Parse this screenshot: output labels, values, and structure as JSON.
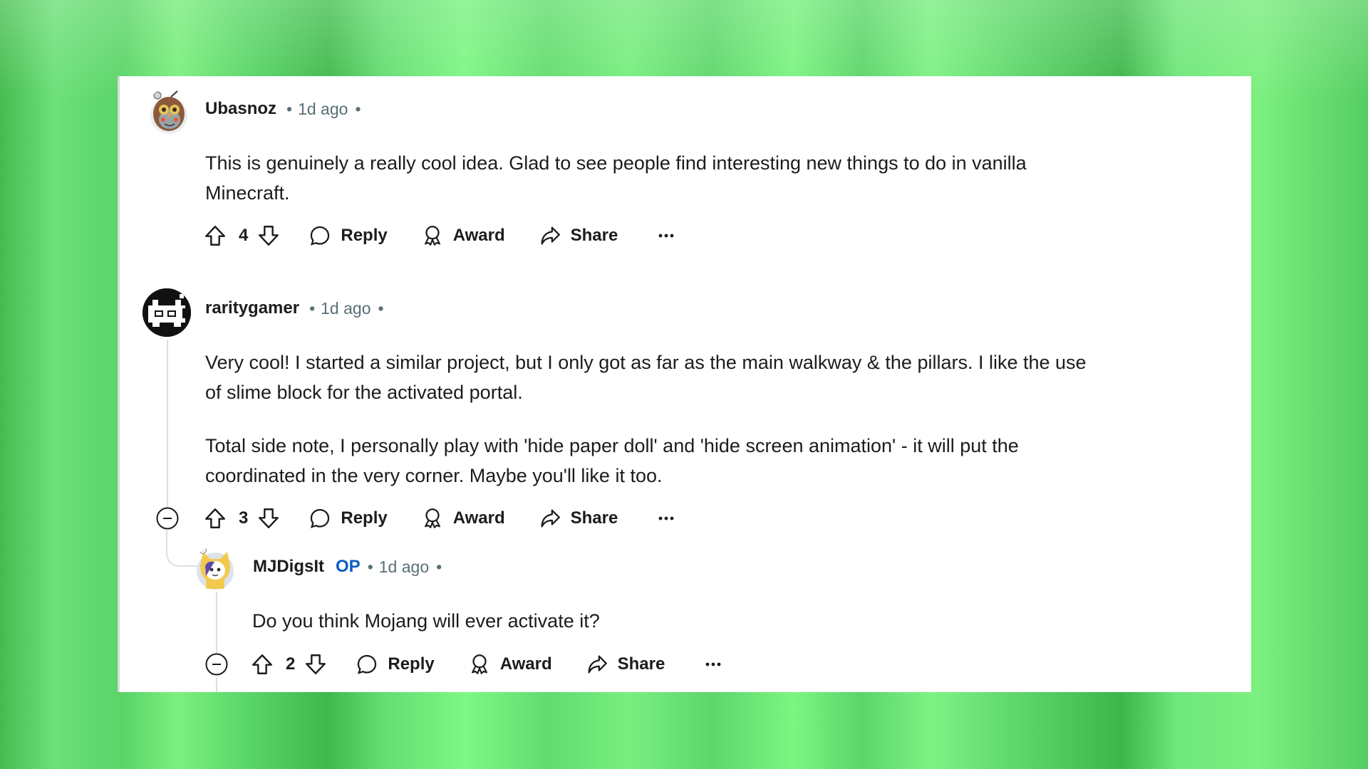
{
  "comments": [
    {
      "username": "Ubasnoz",
      "time": "1d ago",
      "body": [
        "This is genuinely a really cool idea. Glad to see people find interesting new things to do in vanilla",
        "Minecraft."
      ],
      "votes": "4",
      "actions": {
        "reply": "Reply",
        "award": "Award",
        "share": "Share"
      }
    },
    {
      "username": "raritygamer",
      "time": "1d ago",
      "body": [
        "Very cool! I started a similar project, but I only got as far as the main walkway & the pillars. I like the use",
        "of slime block for the activated portal."
      ],
      "body2": [
        "Total side note, I personally play with 'hide paper doll' and 'hide screen animation' - it will put the",
        "coordinated in the very corner. Maybe you'll like it too."
      ],
      "votes": "3",
      "actions": {
        "reply": "Reply",
        "award": "Award",
        "share": "Share"
      }
    },
    {
      "username": "MJDigsIt",
      "badge": "OP",
      "time": "1d ago",
      "body": [
        "Do you think Mojang will ever activate it?"
      ],
      "votes": "2",
      "actions": {
        "reply": "Reply",
        "award": "Award",
        "share": "Share"
      }
    }
  ],
  "separator": "•",
  "colors": {
    "op": "#0a5dc2",
    "text": "#1c1c1c",
    "meta": "#576f76",
    "background": "#6ee37a"
  }
}
